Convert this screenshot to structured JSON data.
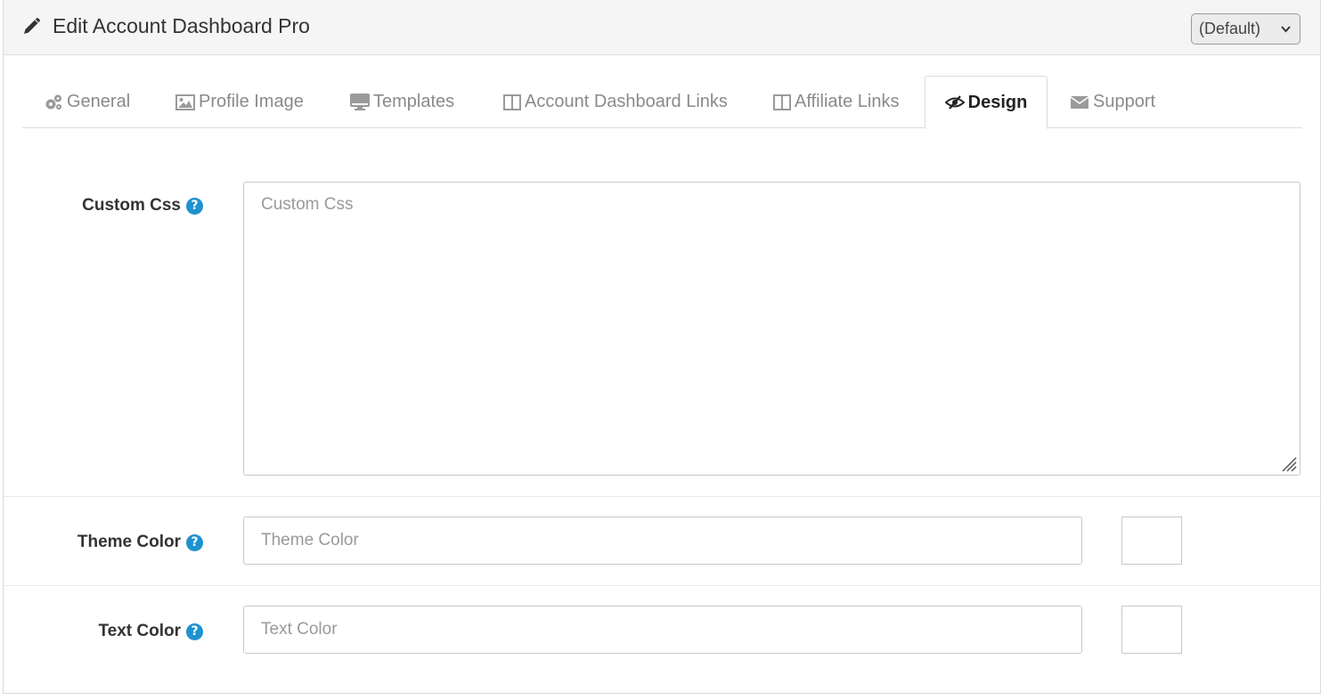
{
  "header": {
    "title": "Edit Account Dashboard Pro",
    "title_icon": "pencil-icon",
    "store_select": {
      "selected": "(Default)"
    }
  },
  "tabs": [
    {
      "label": "General",
      "icon": "cogs-icon",
      "active": false
    },
    {
      "label": "Profile Image",
      "icon": "image-icon",
      "active": false
    },
    {
      "label": "Templates",
      "icon": "monitor-icon",
      "active": false
    },
    {
      "label": "Account Dashboard Links",
      "icon": "columns-icon",
      "active": false
    },
    {
      "label": "Affiliate Links",
      "icon": "columns-icon",
      "active": false
    },
    {
      "label": "Design",
      "icon": "eye-slash-icon",
      "active": true
    },
    {
      "label": "Support",
      "icon": "envelope-icon",
      "active": false
    }
  ],
  "form": {
    "custom_css": {
      "label": "Custom Css",
      "placeholder": "Custom Css",
      "value": ""
    },
    "theme_color": {
      "label": "Theme Color",
      "placeholder": "Theme Color",
      "value": ""
    },
    "text_color": {
      "label": "Text Color",
      "placeholder": "Text Color",
      "value": ""
    },
    "help_glyph": "?"
  },
  "colors": {
    "help_icon": "#1e91cf",
    "heading_bg": "#f5f5f5",
    "border": "#dcdcdc"
  }
}
